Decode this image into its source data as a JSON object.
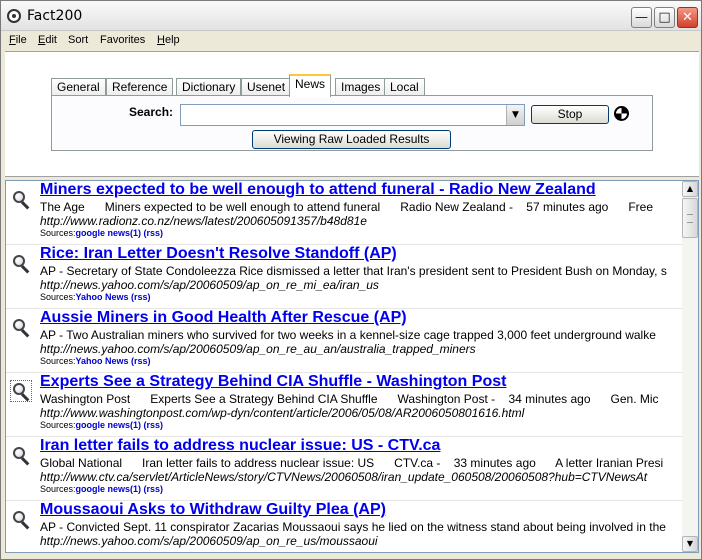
{
  "window": {
    "title": "Fact200"
  },
  "menu": [
    {
      "label": "File",
      "accel": "F",
      "rest": "ile"
    },
    {
      "label": "Edit",
      "accel": "E",
      "rest": "dit"
    },
    {
      "label": "Sort",
      "accel": "",
      "rest": "Sort"
    },
    {
      "label": "Favorites",
      "accel": "",
      "rest": "Favorites"
    },
    {
      "label": "Help",
      "accel": "H",
      "rest": "elp"
    }
  ],
  "tabs": [
    "General",
    "Reference",
    "Dictionary",
    "Usenet",
    "News",
    "Images",
    "Local"
  ],
  "active_tab": "News",
  "search": {
    "label": "Search:",
    "value": "",
    "placeholder": ""
  },
  "buttons": {
    "stop": "Stop",
    "raw": "Viewing Raw Loaded Results"
  },
  "results": [
    {
      "title": "Miners expected to be well enough to attend funeral - Radio New Zealand",
      "snippet": "The Age      Miners expected to be well enough to attend funeral      Radio New Zealand -    57 minutes ago      Free",
      "url": "http://www.radionz.co.nz/news/latest/200605091357/b48d81e",
      "sources_label": "Sources:",
      "sources": "google news(1) (rss)"
    },
    {
      "title": "Rice: Iran Letter Doesn't Resolve Standoff    (AP)",
      "snippet": "AP - Secretary of State Condoleezza Rice dismissed a letter that Iran's president sent to President Bush on Monday, s",
      "url": "http://news.yahoo.com/s/ap/20060509/ap_on_re_mi_ea/iran_us",
      "sources_label": "Sources:",
      "sources": "Yahoo News (rss)"
    },
    {
      "title": "Aussie Miners in Good Health After Rescue    (AP)",
      "snippet": "AP - Two Australian miners who survived for two weeks in a kennel-size cage trapped 3,000 feet underground walke",
      "url": "http://news.yahoo.com/s/ap/20060509/ap_on_re_au_an/australia_trapped_miners",
      "sources_label": "Sources:",
      "sources": "Yahoo News (rss)"
    },
    {
      "title": "Experts See a Strategy Behind CIA Shuffle - Washington Post",
      "snippet": "Washington Post      Experts See a Strategy Behind CIA Shuffle      Washington Post -    34 minutes ago      Gen. Mic",
      "url": "http://www.washingtonpost.com/wp-dyn/content/article/2006/05/08/AR2006050801616.html",
      "sources_label": "Sources:",
      "sources": "google news(1) (rss)"
    },
    {
      "title": "Iran letter fails to address nuclear issue: US - CTV.ca",
      "snippet": "Global National      Iran letter fails to address nuclear issue: US      CTV.ca -    33 minutes ago      A letter Iranian Presi",
      "url": "http://www.ctv.ca/servlet/ArticleNews/story/CTVNews/20060508/iran_update_060508/20060508?hub=CTVNewsAt",
      "sources_label": "Sources:",
      "sources": "google news(1) (rss)"
    },
    {
      "title": "Moussaoui Asks to Withdraw Guilty Plea    (AP)",
      "snippet": "AP - Convicted Sept. 11 conspirator Zacarias Moussaoui says he lied on the witness stand about being involved in the",
      "url": "http://news.yahoo.com/s/ap/20060509/ap_on_re_us/moussaoui",
      "sources_label": "",
      "sources": ""
    }
  ]
}
